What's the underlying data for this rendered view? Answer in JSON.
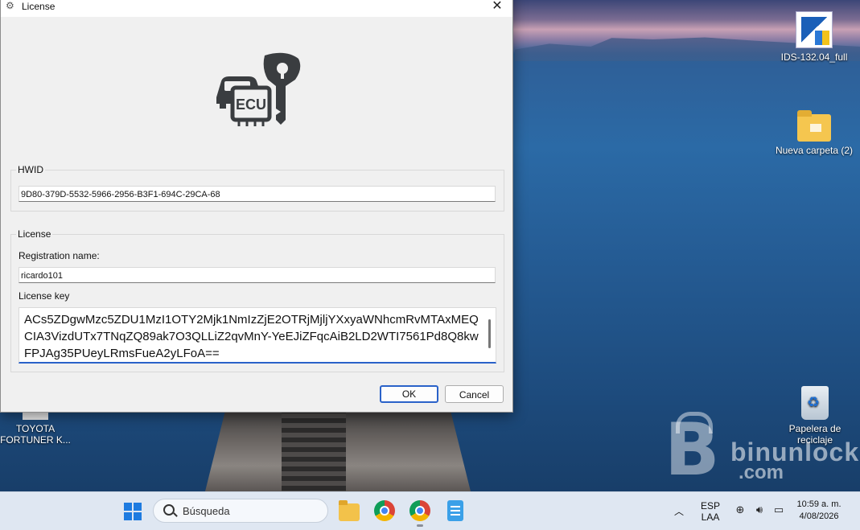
{
  "dialog": {
    "title": "License",
    "close_glyph": "✕",
    "logo_text": "ECU",
    "hwid_group_label": "HWID",
    "hwid_value": "9D80-379D-5532-5966-2956-B3F1-694C-29CA-68",
    "license_group_label": "License",
    "registration_name_label": "Registration name:",
    "registration_name_value": "ricardo101",
    "license_key_label": "License key",
    "license_key_value": "ACs5ZDgwMzc5ZDU1MzI1OTY2Mjk1NmIzZjE2OTRjMjljYXxyaWNhcmRvMTAxMEQCIA3VizdUTx7TNqZQ89ak7O3QLLiZ2qvMnY-YeEJiZFqcAiB2LD2WTI7561Pd8Q8kwFPJAg35PUeyLRmsFueA2yLFoA==",
    "ok_label": "OK",
    "cancel_label": "Cancel"
  },
  "desktop": {
    "icons": [
      {
        "label": "IDS-132.04_full",
        "icon": "ids-app-icon"
      },
      {
        "label": "Nueva carpeta (2)",
        "icon": "folder-icon"
      },
      {
        "label": "Papelera de reciclaje",
        "icon": "recycle-bin-icon"
      },
      {
        "label": "TOYOTA FORTUNER K...",
        "icon": "file-icon"
      }
    ],
    "watermark": {
      "brand": "binunlock",
      "domain": ".com"
    }
  },
  "taskbar": {
    "search_placeholder": "Búsqueda",
    "apps": [
      "file-explorer-icon",
      "chrome-icon",
      "chrome-profile-icon",
      "notepad-icon"
    ],
    "language_line1": "ESP",
    "language_line2": "LAA",
    "time": "10:59 a. m.",
    "date": "4/08/2026"
  }
}
